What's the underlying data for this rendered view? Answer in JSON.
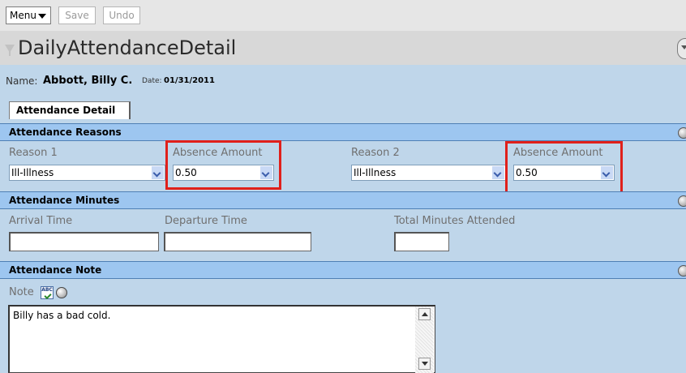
{
  "toolbar": {
    "menu_label": "Menu",
    "save_label": "Save",
    "undo_label": "Undo"
  },
  "page": {
    "title": "DailyAttendanceDetail"
  },
  "student": {
    "name_label": "Name:",
    "name": "Abbott, Billy C.",
    "date_label": "Date:",
    "date": "01/31/2011"
  },
  "tabs": [
    {
      "label": "Attendance Detail",
      "active": true
    }
  ],
  "sections": {
    "reasons": {
      "title": "Attendance Reasons",
      "reason1_label": "Reason 1",
      "reason1_value": "Ill-Illness",
      "absence1_label": "Absence Amount",
      "absence1_value": "0.50",
      "reason2_label": "Reason 2",
      "reason2_value": "Ill-Illness",
      "absence2_label": "Absence Amount",
      "absence2_value": "0.50"
    },
    "minutes": {
      "title": "Attendance Minutes",
      "arrival_label": "Arrival Time",
      "arrival_value": "",
      "departure_label": "Departure Time",
      "departure_value": "",
      "total_label": "Total Minutes Attended",
      "total_value": ""
    },
    "note": {
      "title": "Attendance Note",
      "note_label": "Note",
      "note_value": "Billy has a bad cold."
    }
  },
  "icons": {
    "filter": "funnel-icon",
    "collapse": "circle-icon",
    "spellcheck": "spellcheck-icon",
    "dropdown": "chevron-down-icon"
  },
  "colors": {
    "content_bg": "#bfd6ea",
    "section_header": "#9dc6f0",
    "highlight": "#e0201b",
    "toolbar_bg": "#e6e6e6"
  }
}
